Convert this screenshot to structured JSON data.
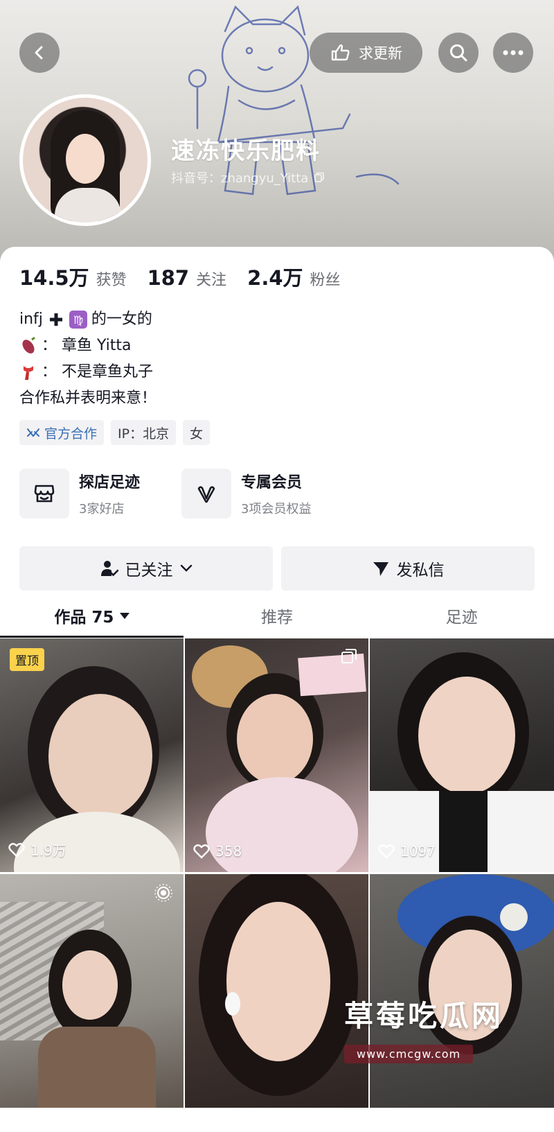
{
  "header": {
    "request_update_label": "求更新",
    "username": "速冻快乐肥料",
    "douyin_id": "抖音号：zhangyu_Yitta"
  },
  "stats": {
    "likes_count": "14.5万",
    "likes_label": "获赞",
    "following_count": "187",
    "following_label": "关注",
    "followers_count": "2.4万",
    "followers_label": "粉丝"
  },
  "bio": {
    "line1_a": "infj",
    "line1_b": "的一女的",
    "line2": "：  章鱼 Yitta",
    "line3": "：  不是章鱼丸子",
    "line4": "合作私并表明来意！"
  },
  "tags": {
    "official": "官方合作",
    "ip": "IP：北京",
    "gender": "女"
  },
  "features": [
    {
      "title": "探店足迹",
      "sub": "3家好店"
    },
    {
      "title": "专属会员",
      "sub": "3项会员权益"
    }
  ],
  "actions": {
    "followed": "已关注",
    "message": "发私信"
  },
  "tabs": {
    "works": "作品 75",
    "recommend": "推荐",
    "footprint": "足迹"
  },
  "grid": {
    "pinned_label": "置顶",
    "tiles": [
      {
        "likes": "1.9万"
      },
      {
        "likes": "358"
      },
      {
        "likes": "1097"
      },
      {
        "likes": ""
      },
      {
        "likes": ""
      },
      {
        "likes": ""
      }
    ]
  },
  "watermark": {
    "title": "草莓吃瓜网",
    "url": "www.cmcgw.com"
  },
  "colors": {
    "text_primary": "#161823",
    "text_secondary": "#6b6d74",
    "button_bg": "#f2f2f4",
    "pinned_badge": "#fbd24c",
    "official_tag": "#3a6fb5"
  }
}
